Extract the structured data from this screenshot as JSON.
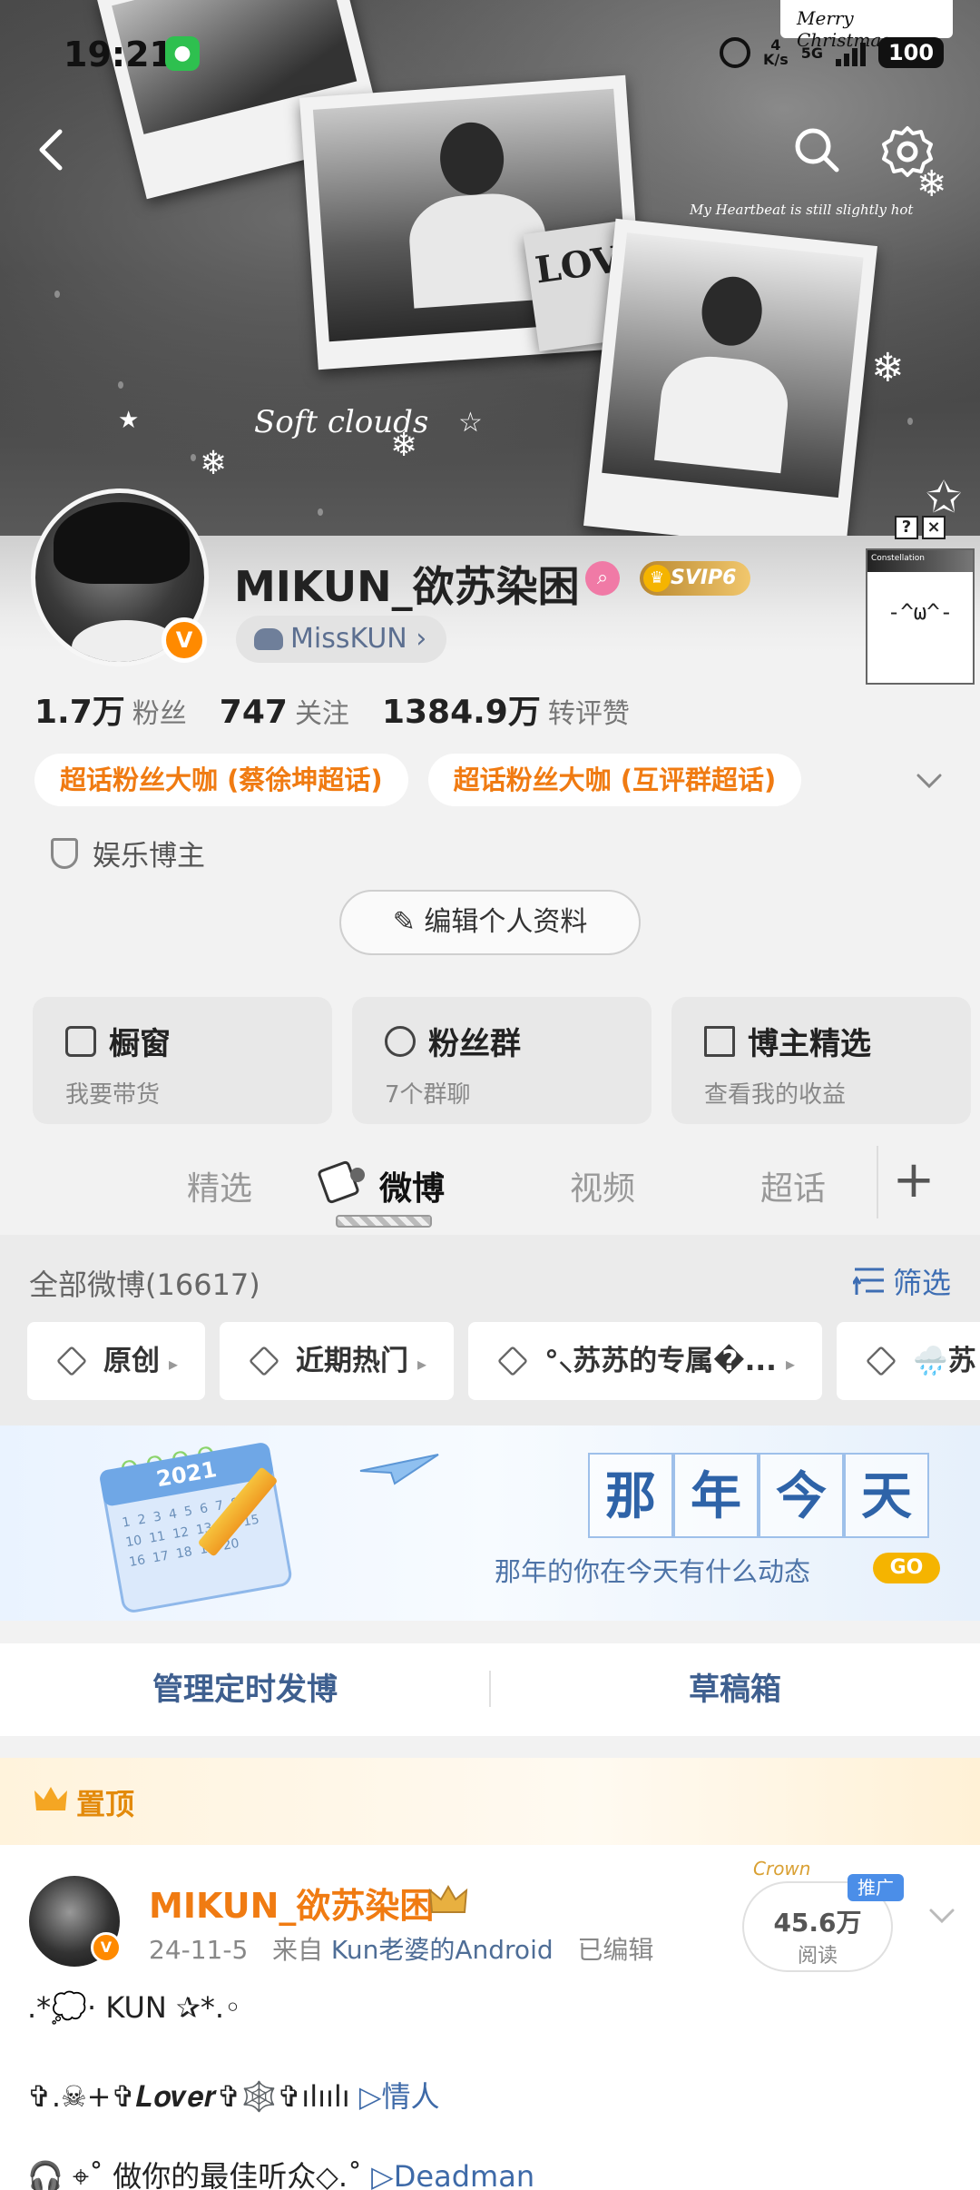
{
  "status_bar": {
    "time": "19:21",
    "net_speed_top": "4",
    "net_speed_unit": "K/s",
    "network": "5G",
    "battery": "100"
  },
  "cover": {
    "xmas_tag": "Merry Christmas",
    "script_text": "My Heartbeat is still slightly hot",
    "sticker_text": "Soft clouds",
    "love_text": "LOVE"
  },
  "header_icons": {
    "back": "back-arrow-icon",
    "search": "search-icon",
    "settings": "gear-icon"
  },
  "profile": {
    "nickname": "MIKUN_欲苏染困",
    "svip": "SVIP6",
    "alt_name": "MissKUN ›",
    "stats": [
      {
        "num": "1.7万",
        "label": "粉丝"
      },
      {
        "num": "747",
        "label": "关注"
      },
      {
        "num": "1384.9万",
        "label": "转评赞"
      }
    ],
    "tags": [
      "超话粉丝大咖 (蔡徐坤超话)",
      "超话粉丝大咖 (互评群超话)"
    ],
    "role": "娱乐博主",
    "edit_button": "编辑个人资料",
    "cards": [
      {
        "title": "橱窗",
        "sub": "我要带货"
      },
      {
        "title": "粉丝群",
        "sub": "7个群聊"
      },
      {
        "title": "博主精选",
        "sub": "查看我的收益"
      }
    ],
    "constellation_label": "Constellation",
    "constellation_face": "-^ω^-"
  },
  "tabs": [
    "精选",
    "微博",
    "视频",
    "超话"
  ],
  "feed": {
    "count_label": "全部微博(16617)",
    "filter_label": "筛选",
    "chips": [
      "原创",
      "近期热门",
      "°⸜苏苏的专属�...",
      "🌧️苏"
    ]
  },
  "banner": {
    "chars": [
      "那",
      "年",
      "今",
      "天"
    ],
    "subtitle": "那年的你在今天有什么动态",
    "go": "GO",
    "calendar_year": "2021"
  },
  "actions": {
    "scheduled": "管理定时发博",
    "drafts": "草稿箱"
  },
  "post": {
    "pin_label": "置顶",
    "author": "MIKUN_欲苏染困",
    "date": "24-11-5",
    "source_prefix": "来自",
    "source": "Kun老婆的Android",
    "edited": "已编辑",
    "reads_num": "45.6万",
    "reads_label": "阅读",
    "promo": "推广",
    "promo_deco": "Crown",
    "lines": [
      {
        "text": ".*💭· KUN ✰*.◦",
        "link": ""
      },
      {
        "text": "✞.☠︎+✞𝑳𝒐𝒗𝒆𝒓✞🕸️✞ılıılı ",
        "link": "▷情人"
      },
      {
        "text": "🎧 ⌖˚ 做你的最佳听众◇.˚ ",
        "link": "▷Deadman"
      }
    ]
  }
}
